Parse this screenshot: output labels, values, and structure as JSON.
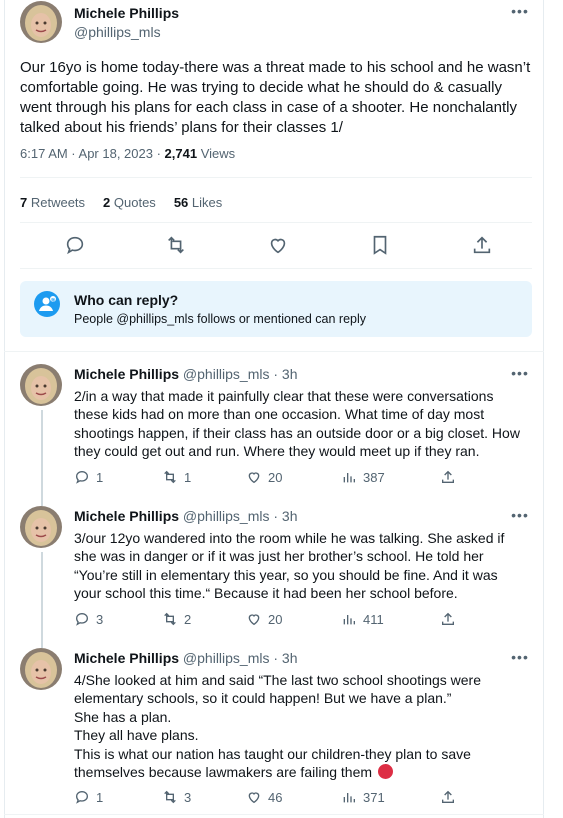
{
  "main_tweet": {
    "author_name": "Michele Phillips",
    "author_handle": "@phillips_mls",
    "text": "Our 16yo is home today-there was a threat made to his school and he wasn’t comfortable going. He was trying to decide what he should do & casually went through his plans for each class in case of a shooter. He nonchalantly talked about his friends’ plans for their classes 1/",
    "time": "6:17 AM · Apr 18, 2023 · ",
    "views_count": "2,741",
    "views_label": " Views",
    "retweets_count": "7",
    "retweets_label": " Retweets",
    "quotes_count": "2",
    "quotes_label": " Quotes",
    "likes_count": "56",
    "likes_label": " Likes"
  },
  "who_can_reply": {
    "title": "Who can reply?",
    "subtitle": "People @phillips_mls follows or mentioned can reply"
  },
  "replies": [
    {
      "author_name": "Michele Phillips",
      "meta": "@phillips_mls · 3h",
      "text": "2/in a way that made it painfully clear that these were conversations these kids had on more than one occasion. What time of day most shootings happen, if their class has an outside door or a big closet. How they could get out and run. Where they would meet up if they ran.",
      "replies": "1",
      "retweets": "1",
      "likes": "20",
      "views": "387"
    },
    {
      "author_name": "Michele Phillips",
      "meta": "@phillips_mls · 3h",
      "text": "3/our 12yo wandered into the room while he was talking. She asked if she was in danger or if it was just her brother’s school. He told her “You’re still in elementary this year, so you should be fine. And it was your school this time.“ Because it had been her school before.",
      "replies": "3",
      "retweets": "2",
      "likes": "20",
      "views": "411"
    },
    {
      "author_name": "Michele Phillips",
      "meta": "@phillips_mls · 3h",
      "text_lines": [
        "4/She looked at him and said “The last two school shootings were elementary schools, so it could happen! But we have a plan.”",
        "She has a plan.",
        "They all have plans.",
        "This is what our nation has taught our children-they plan to save themselves because lawmakers are failing them"
      ],
      "emoji": "red-circle-icon",
      "replies": "1",
      "retweets": "3",
      "likes": "46",
      "views": "371"
    }
  ],
  "colors": {
    "accent": "#1d9bf0",
    "secondary_text": "#536471",
    "reply_box_bg": "#e8f5fd"
  }
}
